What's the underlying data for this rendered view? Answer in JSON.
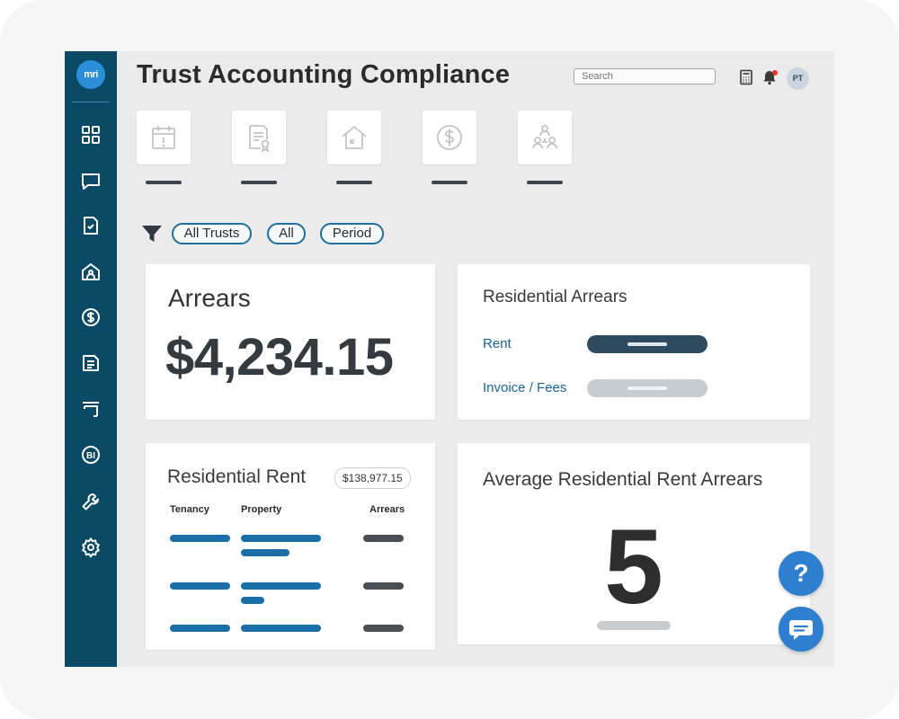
{
  "app": {
    "title": "Trust Accounting Compliance",
    "logo_text": "mri",
    "colors": {
      "sidebar": "#0b4a66",
      "accent": "#1f6f9e",
      "link": "#1565a0",
      "fab": "#2f7fd1",
      "notification": "#e0352b"
    }
  },
  "header": {
    "search_placeholder": "Search",
    "icons": [
      "calculator-icon",
      "bell-icon"
    ],
    "avatar_initials": "PT",
    "has_notification": true
  },
  "sidebar": {
    "items": [
      {
        "icon": "dashboard-grid-icon"
      },
      {
        "icon": "chat-icon"
      },
      {
        "icon": "checklist-icon"
      },
      {
        "icon": "home-person-icon"
      },
      {
        "icon": "dollar-icon"
      },
      {
        "icon": "document-icon"
      },
      {
        "icon": "form-icon"
      },
      {
        "icon": "bi-icon"
      },
      {
        "icon": "wrench-icon"
      },
      {
        "icon": "settings-icon"
      }
    ]
  },
  "tiles": [
    {
      "icon": "calendar-alert-icon"
    },
    {
      "icon": "certificate-icon"
    },
    {
      "icon": "house-arrow-icon"
    },
    {
      "icon": "dollar-circle-icon"
    },
    {
      "icon": "people-group-icon"
    }
  ],
  "filters": {
    "icon": "filter-icon",
    "pills": [
      "All Trusts",
      "All",
      "Period"
    ]
  },
  "arrears_card": {
    "title": "Arrears",
    "value": "$4,234.15"
  },
  "residential_arrears_card": {
    "title": "Residential Arrears",
    "rows": [
      {
        "label": "Rent",
        "bar_color": "#2e4a5e",
        "inner_color": "#dfe6ec"
      },
      {
        "label": "Invoice / Fees",
        "bar_color": "#c7ccd1",
        "inner_color": "#f1f3f5"
      }
    ]
  },
  "residential_rent_card": {
    "title": "Residential Rent",
    "total": "$138,977.15",
    "columns": [
      "Tenancy",
      "Property",
      "Arrears"
    ]
  },
  "average_card": {
    "title": "Average Residential Rent Arrears",
    "value": "5"
  },
  "floating": {
    "help_label": "?",
    "help_icon": "help-icon",
    "chat_icon": "chat-bubble-icon"
  }
}
